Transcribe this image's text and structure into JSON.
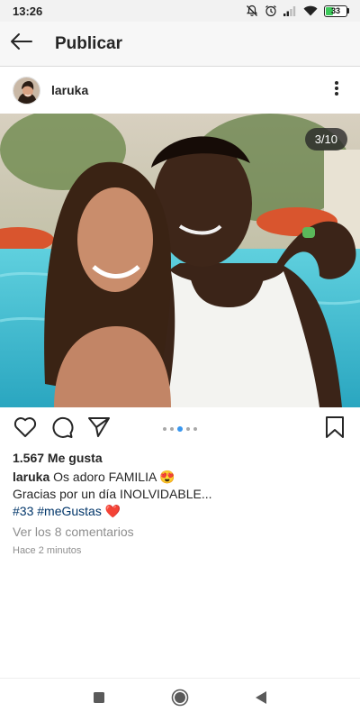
{
  "status_bar": {
    "time": "13:26",
    "battery_level": "33",
    "battery_fraction": 0.33
  },
  "app_bar": {
    "title": "Publicar",
    "back_icon": "arrow-left-icon"
  },
  "post": {
    "username": "laruka",
    "image_counter": "3/10",
    "carousel_dots": 5,
    "carousel_active_index": 2,
    "likes": "1.567 Me gusta",
    "caption_user": "laruka",
    "caption_line1": "Os adoro FAMILIA",
    "caption_emoji": "😍",
    "caption_line2": "Gracias por un día INOLVIDABLE...",
    "hashtag1": "#33",
    "hashtag2": "#meGustas",
    "hashtag_emoji": "❤️",
    "comments_link": "Ver los 8 comentarios",
    "timestamp": "Hace 2 minutos"
  },
  "colors": {
    "accent_blue": "#3897f0",
    "hashtag": "#003569",
    "muted_text": "#8e8e8e",
    "battery_green": "#3cc95a"
  },
  "icons": {
    "like": "heart-outline-icon",
    "comment": "comment-bubble-icon",
    "share": "paper-plane-icon",
    "save": "bookmark-icon",
    "more": "vertical-dots-icon",
    "nav_recents": "square-icon",
    "nav_home": "circle-icon",
    "nav_back": "triangle-back-icon"
  }
}
